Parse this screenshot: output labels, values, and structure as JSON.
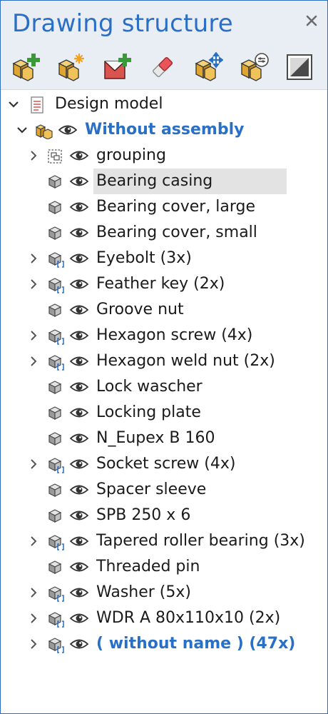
{
  "panel": {
    "title": "Drawing structure",
    "close_icon": "close-icon"
  },
  "toolbar": {
    "buttons": [
      {
        "name": "add-component-icon"
      },
      {
        "name": "new-component-icon"
      },
      {
        "name": "add-drawing-icon"
      },
      {
        "name": "eraser-icon"
      },
      {
        "name": "move-component-icon"
      },
      {
        "name": "settings-component-icon"
      },
      {
        "name": "frame-icon"
      }
    ]
  },
  "tree": {
    "root": {
      "label": "Design model",
      "icon": "document-icon",
      "expanded": true
    },
    "group": {
      "label": "Without assembly",
      "icon": "assembly-icon",
      "expanded": true
    },
    "items": [
      {
        "label": "grouping",
        "icon": "grouping-icon",
        "expandable": true,
        "selected": false
      },
      {
        "label": "Bearing casing",
        "icon": "part-icon",
        "expandable": false,
        "selected": true
      },
      {
        "label": "Bearing cover, large",
        "icon": "part-icon",
        "expandable": false,
        "selected": false
      },
      {
        "label": "Bearing cover, small",
        "icon": "part-icon",
        "expandable": false,
        "selected": false
      },
      {
        "label": "Eyebolt (3x)",
        "icon": "multi-part-icon",
        "expandable": true,
        "selected": false
      },
      {
        "label": "Feather key (2x)",
        "icon": "multi-part-icon",
        "expandable": true,
        "selected": false
      },
      {
        "label": "Groove nut",
        "icon": "part-icon",
        "expandable": false,
        "selected": false
      },
      {
        "label": "Hexagon screw (4x)",
        "icon": "multi-part-icon",
        "expandable": true,
        "selected": false
      },
      {
        "label": "Hexagon weld nut (2x)",
        "icon": "multi-part-icon",
        "expandable": true,
        "selected": false
      },
      {
        "label": "Lock wascher",
        "icon": "part-icon",
        "expandable": false,
        "selected": false
      },
      {
        "label": "Locking plate",
        "icon": "part-icon",
        "expandable": false,
        "selected": false
      },
      {
        "label": "N_Eupex B 160",
        "icon": "part-icon",
        "expandable": false,
        "selected": false
      },
      {
        "label": "Socket screw (4x)",
        "icon": "multi-part-icon",
        "expandable": true,
        "selected": false
      },
      {
        "label": "Spacer sleeve",
        "icon": "part-icon",
        "expandable": false,
        "selected": false
      },
      {
        "label": "SPB 250 x 6",
        "icon": "part-icon",
        "expandable": false,
        "selected": false
      },
      {
        "label": "Tapered roller bearing (3x)",
        "icon": "multi-part-icon",
        "expandable": true,
        "selected": false
      },
      {
        "label": "Threaded pin",
        "icon": "part-icon",
        "expandable": false,
        "selected": false
      },
      {
        "label": "Washer (5x)",
        "icon": "multi-part-icon",
        "expandable": true,
        "selected": false
      },
      {
        "label": "WDR A 80x110x10 (2x)",
        "icon": "multi-part-icon",
        "expandable": true,
        "selected": false
      },
      {
        "label": "( without name ) (47x)",
        "icon": "multi-part-icon",
        "expandable": true,
        "selected": false,
        "highlight": true
      }
    ]
  },
  "colors": {
    "accent": "#2a6fc6",
    "header_bg": "#e9eef5",
    "selection_bg": "#e3e3e3"
  }
}
